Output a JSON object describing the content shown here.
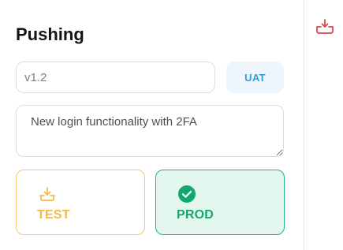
{
  "panel": {
    "title": "Pushing",
    "version_input": {
      "value": "v1.2",
      "placeholder": ""
    },
    "environment_button": "UAT",
    "description_field": {
      "value": "New login functionality with 2FA"
    },
    "targets": [
      {
        "label": "TEST",
        "icon": "download-tray-icon",
        "selected": false
      },
      {
        "label": "PROD",
        "icon": "check-circle-icon",
        "selected": true
      }
    ]
  },
  "side": {
    "icon": "download-tray-icon"
  },
  "colors": {
    "test_accent": "#f2b94a",
    "prod_accent": "#12a86e",
    "prod_bg": "#e4f7ee",
    "uat_accent": "#2ea0d8",
    "side_icon": "#e2434f"
  }
}
